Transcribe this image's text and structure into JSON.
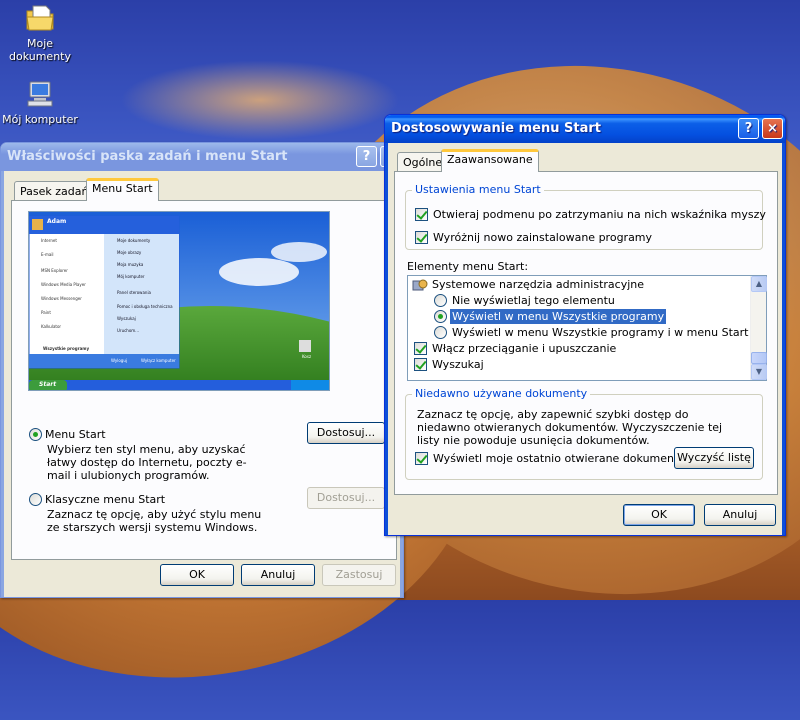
{
  "desktop": {
    "icons": [
      {
        "label": "Moje dokumenty",
        "icon": "my-documents-icon"
      },
      {
        "label": "Mój komputer",
        "icon": "my-computer-icon"
      }
    ]
  },
  "taskbar_props_window": {
    "title": "Właściwości paska zadań i menu Start",
    "help_btn": "?",
    "close_btn": "×",
    "tabs": [
      "Pasek zadań",
      "Menu Start"
    ],
    "active_tab": "Menu Start",
    "preview": {
      "user": "Adam",
      "start_label": "Start",
      "all_programs": "Wszystkie programy",
      "desktop_icon": "Kosz",
      "left_items": [
        "Internet",
        "E-mail",
        "MSN Explorer",
        "Windows Media Player",
        "Windows Messenger",
        "Paint",
        "Kalkulator"
      ],
      "right_items": [
        "Moje dokumenty",
        "Moje obrazy",
        "Moja muzyka",
        "Mój komputer",
        "Panel sterowania",
        "Pomoc i obsługa techniczna",
        "Wyszukaj",
        "Uruchom..."
      ],
      "logoff": "Wyloguj",
      "shutdown": "Wyłącz komputer"
    },
    "option_start": {
      "label": "Menu Start",
      "desc": "Wybierz ten styl menu, aby uzyskać łatwy dostęp do Internetu, poczty e-mail i ulubionych programów.",
      "checked": true
    },
    "option_classic": {
      "label": "Klasyczne menu Start",
      "desc": "Zaznacz tę opcję, aby użyć stylu menu ze starszych wersji systemu Windows.",
      "checked": false
    },
    "customize_btn": "Dostosuj...",
    "customize_btn_disabled": "Dostosuj...",
    "ok": "OK",
    "cancel": "Anuluj",
    "apply": "Zastosuj"
  },
  "customize_window": {
    "title": "Dostosowywanie menu Start",
    "help_btn": "?",
    "close_btn": "×",
    "tabs": [
      "Ogólne",
      "Zaawansowane"
    ],
    "active_tab": "Zaawansowane",
    "settings_group": {
      "title": "Ustawienia menu Start",
      "items": [
        {
          "label": "Otwieraj podmenu po zatrzymaniu na nich wskaźnika myszy",
          "checked": true
        },
        {
          "label": "Wyróżnij nowo zainstalowane programy",
          "checked": true
        }
      ]
    },
    "elements_label": "Elementy menu Start:",
    "elements": {
      "header": "Systemowe narzędzia administracyjne",
      "radios": [
        {
          "label": "Nie wyświetlaj tego elementu",
          "checked": false
        },
        {
          "label": "Wyświetl w menu Wszystkie programy",
          "checked": true,
          "selected": true
        },
        {
          "label": "Wyświetl w menu Wszystkie programy i w menu Start",
          "checked": false
        }
      ],
      "checks": [
        {
          "label": "Włącz przeciąganie i upuszczanie",
          "checked": true
        },
        {
          "label": "Wyszukaj",
          "checked": true
        }
      ]
    },
    "recent_group": {
      "title": "Niedawno używane dokumenty",
      "desc": "Zaznacz tę opcję, aby zapewnić szybki dostęp do niedawno otwieranych dokumentów. Wyczyszczenie tej listy nie powoduje usunięcia dokumentów.",
      "checkbox": "Wyświetl moje ostatnio otwierane dokumenty",
      "checked": true,
      "clear_btn": "Wyczyść listę"
    },
    "ok": "OK",
    "cancel": "Anuluj"
  },
  "colors": {
    "selection": "#316ac5",
    "xp_blue": "#0054e3",
    "group_title": "#0046d5",
    "tab_highlight": "#ffc83c"
  }
}
